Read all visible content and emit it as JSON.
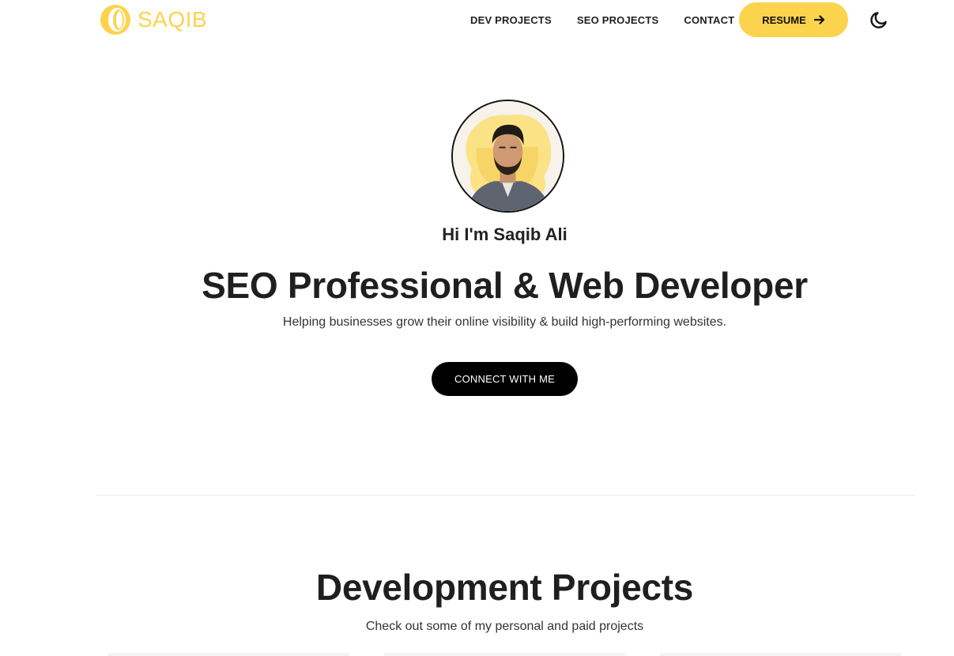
{
  "header": {
    "logo_text": "SAQIB",
    "nav": [
      "DEV PROJECTS",
      "SEO PROJECTS",
      "CONTACT"
    ],
    "resume_label": "RESUME",
    "theme_icon": "moon-icon"
  },
  "hero": {
    "greeting": "Hi I'm Saqib Ali",
    "title": "SEO Professional & Web Developer",
    "subtitle": "Helping businesses grow their online visibility & build high-performing websites.",
    "cta_label": "CONNECT WITH ME"
  },
  "projects": {
    "title": "Development Projects",
    "subtitle": "Check out some of my personal and paid projects"
  },
  "colors": {
    "accent": "#fcd34d",
    "text": "#1f1f1f",
    "button_dark": "#000000"
  }
}
